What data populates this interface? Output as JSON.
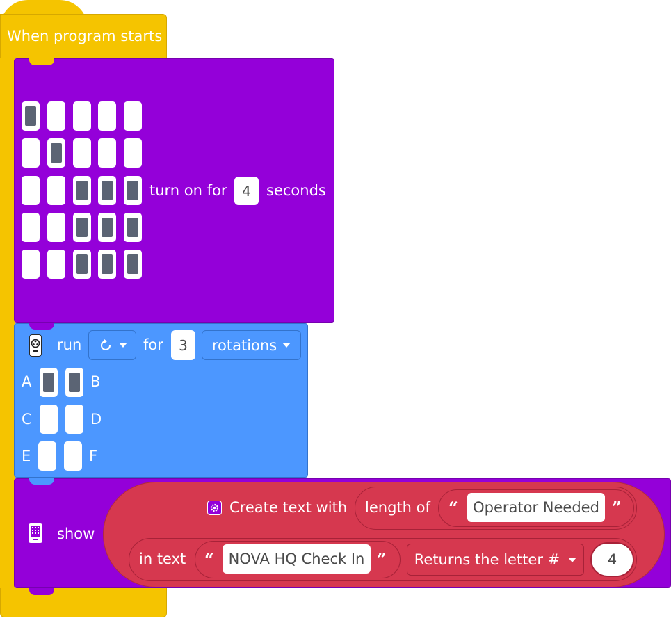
{
  "event": {
    "title": "When program starts"
  },
  "matrix": {
    "leds": [
      [
        true,
        false,
        false,
        false,
        false
      ],
      [
        false,
        true,
        false,
        false,
        false
      ],
      [
        false,
        false,
        true,
        true,
        true
      ],
      [
        false,
        false,
        true,
        true,
        true
      ],
      [
        false,
        false,
        true,
        true,
        true
      ]
    ],
    "label": "turn on for",
    "duration": "4",
    "unit": "seconds"
  },
  "motor": {
    "icon": "motor-icon",
    "run_label": "run",
    "direction_icon": "clockwise-icon",
    "for_label": "for",
    "amount": "3",
    "unit": "rotations",
    "ports": [
      {
        "left": "A",
        "right": "B",
        "left_on": true,
        "right_on": true
      },
      {
        "left": "C",
        "right": "D",
        "left_on": false,
        "right_on": false
      },
      {
        "left": "E",
        "right": "F",
        "left_on": false,
        "right_on": false
      }
    ]
  },
  "show": {
    "icon": "display-icon",
    "label": "show",
    "create_text": {
      "icon": "gear-icon",
      "label": "Create text with",
      "length_of": "length of",
      "string1": "Operator Needed",
      "in_text": "in text",
      "string2": "NOVA HQ Check In",
      "mode": "Returns the letter #",
      "index": "4"
    }
  },
  "colors": {
    "events": "#F5C400",
    "looks": "#9400D9",
    "motors": "#4C97FF",
    "operators": "#D6384F"
  }
}
